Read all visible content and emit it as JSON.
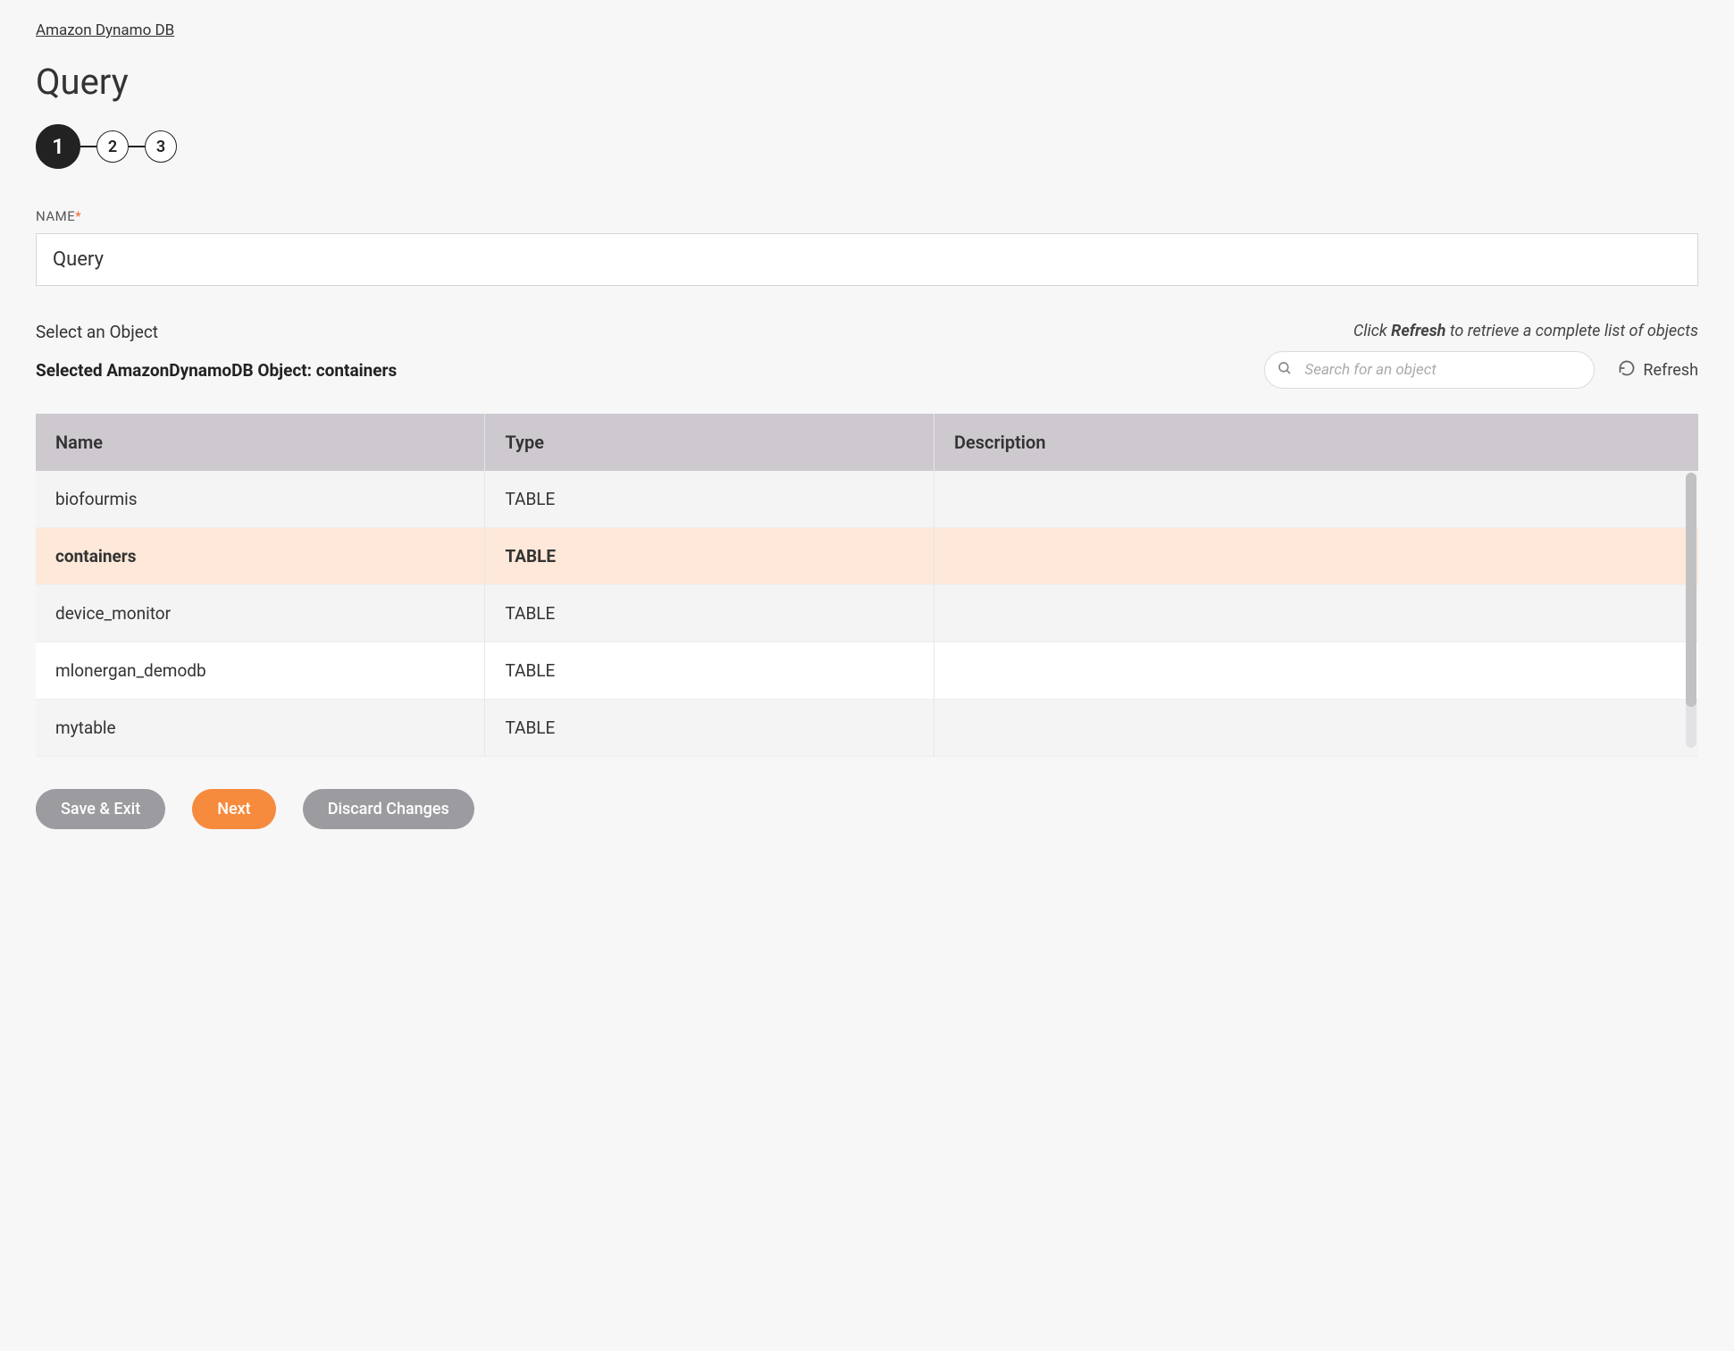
{
  "breadcrumb": "Amazon Dynamo DB",
  "page_title": "Query",
  "stepper": {
    "steps": [
      "1",
      "2",
      "3"
    ],
    "active_index": 0
  },
  "name_field": {
    "label": "NAME",
    "required_mark": "*",
    "value": "Query"
  },
  "select_section": {
    "label": "Select an Object",
    "hint_prefix": "Click ",
    "hint_bold": "Refresh",
    "hint_suffix": " to retrieve a complete list of objects",
    "selected_prefix": "Selected AmazonDynamoDB Object: ",
    "selected_object": "containers",
    "search_placeholder": "Search for an object",
    "refresh_label": "Refresh"
  },
  "table": {
    "columns": [
      "Name",
      "Type",
      "Description"
    ],
    "rows": [
      {
        "name": "biofourmis",
        "type": "TABLE",
        "description": "",
        "selected": false
      },
      {
        "name": "containers",
        "type": "TABLE",
        "description": "",
        "selected": true
      },
      {
        "name": "device_monitor",
        "type": "TABLE",
        "description": "",
        "selected": false
      },
      {
        "name": "mlonergan_demodb",
        "type": "TABLE",
        "description": "",
        "selected": false
      },
      {
        "name": "mytable",
        "type": "TABLE",
        "description": "",
        "selected": false
      }
    ]
  },
  "buttons": {
    "save_exit": "Save & Exit",
    "next": "Next",
    "discard": "Discard Changes"
  }
}
